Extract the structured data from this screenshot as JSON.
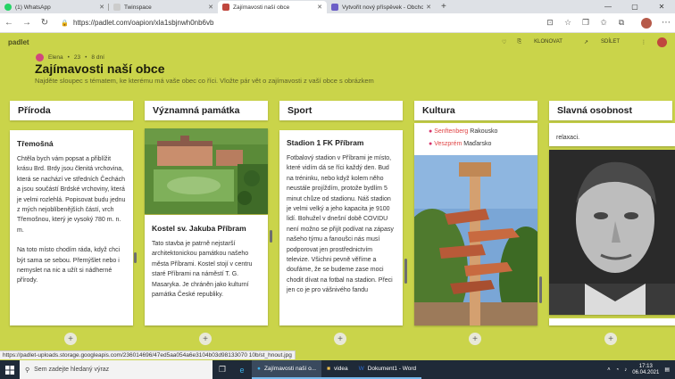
{
  "browser": {
    "tabs": [
      {
        "title": "(1) WhatsApp",
        "color": "#25d366"
      },
      {
        "title": "Twinspace",
        "color": "#e0e0e0"
      },
      {
        "title": "Zajímavosti naší obce",
        "color": "#c0473e"
      },
      {
        "title": "Vytvořit nový příspěvek - Obchod",
        "color": "#6c5fc7"
      }
    ],
    "url": "https://padlet.com/oapion/xla1sbjnwh0nb6vb"
  },
  "padlet": {
    "brand": "padlet",
    "clone_label": "KLONOVAT",
    "share_label": "SDÍLET",
    "author": "Elena",
    "author_count": "23",
    "age": "8 dní",
    "title": "Zajímavosti naší obce",
    "description": "Najděte sloupec s tématem, ke kterému má vaše obec co říci. Vložte pár vět o zajímavosti z vaší obce s obrázkem"
  },
  "columns": {
    "c1": {
      "heading": "Příroda",
      "card_title": "Třemošná",
      "card_body": "Chtěla bych vám popsat a přiblížit krásu Brd. Brdy jsou členitá vrchovina, která se nachází ve středních Čechách a jsou součástí Brdské vrchoviny, která je velmi rozlehlá. Popisovat budu jednu z mých nejoblíbenějších částí, vrch Třemošnou, který je vysoký 780 m. n. m.",
      "card_body2": "Na toto místo chodím ráda, když chci být sama se sebou. Přemýšlet nebo i nemyslet na nic a užít si nádherné přírody."
    },
    "c2": {
      "heading": "Významná památka",
      "card_title": "Kostel sv. Jakuba Příbram",
      "card_body": "Tato stavba je patrně nejstarší architektonickou památkou našeho města Příbrami. Kostel stojí v centru staré Příbrami na náměstí T. G. Masaryka. Je chráněn jako kulturní památka České republiky."
    },
    "c3": {
      "heading": "Sport",
      "card_title": "Stadion 1 FK Příbram",
      "card_body": "Fotbalový stadion v Příbrami je místo, které vidím dá se říci každý den. Bud na tréninku, nebo když kolem něho neustále projíždím, protože bydlím 5 minut chůze od stadionu. Náš stadion je velmi velký a jeho kapacita je 9100 lidí. Bohužel v dnešní době COVIDU není možno se přijít podívat na zápasy našeho týmu a fanoušci nás musí podporovat jen prostřednictvím televize. Všichni pevně věříme a doufáme, že se budeme zase moci chodit dívat na fotbal na stadion. Přeci jen co je pro vášnivého fandu"
    },
    "c4": {
      "heading": "Kultura",
      "list": [
        {
          "link": "Senftenberg",
          "rest": " Rakousko"
        },
        {
          "link": "Veszprém",
          "rest": " Maďarsko"
        }
      ]
    },
    "c5": {
      "heading": "Slavná osobnost",
      "card_body": "relaxaci."
    }
  },
  "status_url": "https://padlet-uploads.storage.googleapis.com/236014696/47ed5aa054a6e3104b03d98133070 10b/st_hnout.jpg",
  "taskbar": {
    "search_placeholder": "Sem zadejte hledaný výraz",
    "apps": [
      "Zajímavosti naší o...",
      "videa",
      "Dokument1 - Word"
    ],
    "time": "17:13",
    "date": "06.04.2021"
  }
}
